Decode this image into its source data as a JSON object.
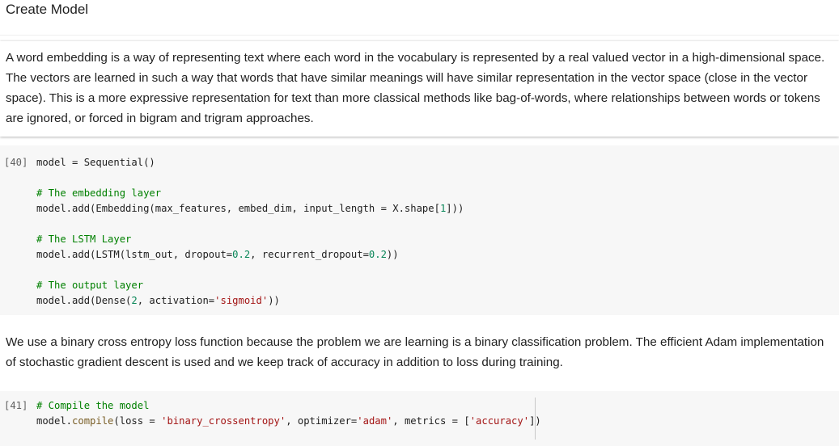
{
  "heading": {
    "title": "Create Model"
  },
  "text1": "A word embedding is a way of representing text where each word in the vocabulary is represented by a real valued vector in a high-dimensional space. The vectors are learned in such a way that words that have similar meanings will have similar representation in the vector space (close in the vector space). This is a more expressive representation for text than more classical methods like bag-of-words, where relationships between words or tokens are ignored, or forced in bigram and trigram approaches.",
  "cell40": {
    "count": "[40]",
    "lines": [
      "model = Sequential()",
      "# The embedding layer",
      "model.add(Embedding(max_features, embed_dim, input_length = X.shape[",
      "1",
      "]))",
      "# The LSTM Layer",
      "model.add(LSTM(lstm_out, dropout=",
      "0.2",
      ", recurrent_dropout=",
      "0.2",
      "))",
      "# The output layer",
      "model.add(Dense(",
      "2",
      ", activation=",
      "'sigmoid'",
      "))"
    ]
  },
  "text2": "We use a binary cross entropy loss function because the problem we are learning is a binary classification problem. The efficient Adam implementation of stochastic gradient descent is used and we keep track of accuracy in addition to loss during training.",
  "cell41": {
    "count": "[41]",
    "lines": [
      "# Compile the model",
      "model.",
      "compile",
      "(loss = ",
      "'binary_crossentropy'",
      ", optimizer=",
      "'adam'",
      ", metrics = [",
      "'accuracy'",
      "])"
    ]
  },
  "colors": {
    "comment": "#008000",
    "number": "#098658",
    "string": "#a31515",
    "function": "#795e26",
    "code_bg": "#f7f7f7"
  }
}
